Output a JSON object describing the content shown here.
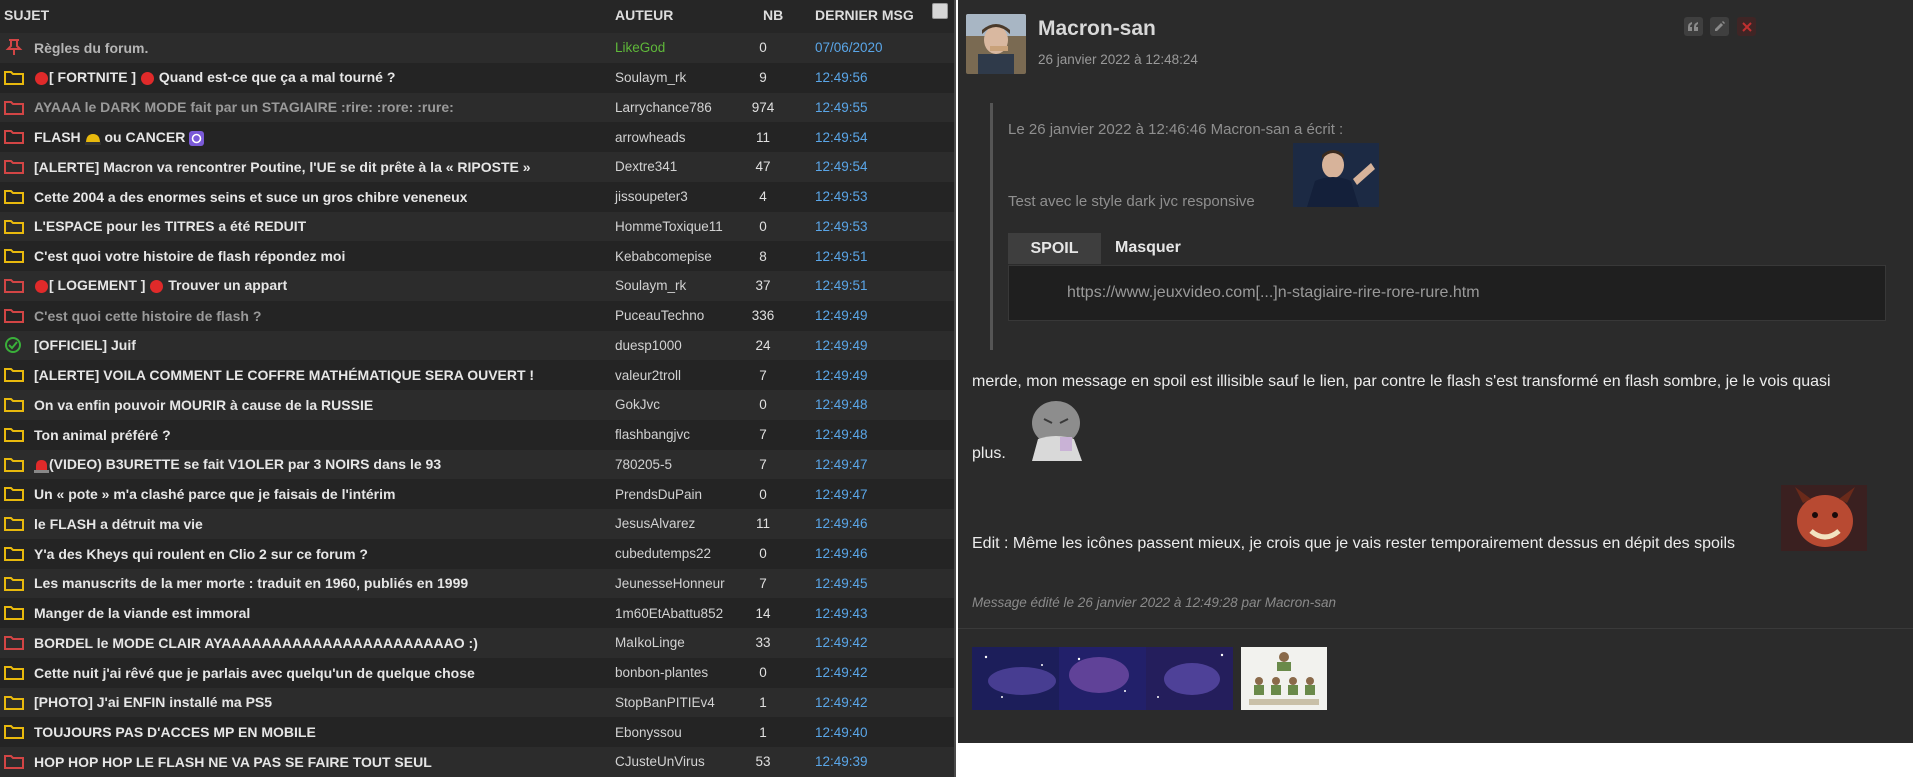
{
  "list": {
    "headers": {
      "subject": "SUJET",
      "author": "AUTEUR",
      "count": "NB",
      "last_msg": "DERNIER MSG"
    },
    "topics": [
      {
        "icon": "pin-icon",
        "subject": "Règles du forum.",
        "author": "LikeGod",
        "count": "0",
        "last": "07/06/2020",
        "style": "pin",
        "author_style": "green"
      },
      {
        "icon": "folder-yellow-icon",
        "pre": "red-dot",
        "subject": "[ FORTNITE ]",
        "mid": "red-dot",
        "subject2": "Quand est-ce que ça a mal tourné ?",
        "author": "Soulaym_rk",
        "count": "9",
        "last": "12:49:56"
      },
      {
        "icon": "folder-red-icon",
        "subject": "AYAAA le DARK MODE fait par un STAGIAIRE :rire: :rore: :rure:",
        "author": "Larrychance786",
        "count": "974",
        "last": "12:49:55",
        "style": "grey"
      },
      {
        "icon": "folder-red-icon",
        "subject": "FLASH",
        "mid": "helmet",
        "subject2": "ou CANCER",
        "post": "cycle",
        "author": "arrowheads",
        "count": "11",
        "last": "12:49:54"
      },
      {
        "icon": "folder-red-icon",
        "subject": "[ALERTE] Macron va rencontrer Poutine, l'UE se dit prête à la « RIPOSTE »",
        "author": "Dextre341",
        "count": "47",
        "last": "12:49:54"
      },
      {
        "icon": "folder-yellow-icon",
        "subject": "Cette 2004 a des enormes seins et suce un gros chibre veneneux",
        "author": "jissoupeter3",
        "count": "4",
        "last": "12:49:53"
      },
      {
        "icon": "folder-yellow-icon",
        "subject": "L'ESPACE pour les TITRES a été REDUIT",
        "author": "HommeToxique11",
        "count": "0",
        "last": "12:49:53"
      },
      {
        "icon": "folder-yellow-icon",
        "subject": "C'est quoi votre histoire de flash répondez moi",
        "author": "Kebabcomepise",
        "count": "8",
        "last": "12:49:51"
      },
      {
        "icon": "folder-red-icon",
        "pre": "red-dot",
        "subject": "[ LOGEMENT ]",
        "mid": "red-dot",
        "subject2": "Trouver un appart",
        "author": "Soulaym_rk",
        "count": "37",
        "last": "12:49:51"
      },
      {
        "icon": "folder-red-icon",
        "subject": "C'est quoi cette histoire de flash ?",
        "author": "PuceauTechno",
        "count": "336",
        "last": "12:49:49",
        "style": "grey"
      },
      {
        "icon": "check-green-icon",
        "subject": "[OFFICIEL] Juif",
        "author": "duesp1000",
        "count": "24",
        "last": "12:49:49"
      },
      {
        "icon": "folder-yellow-icon",
        "subject": "[ALERTE] VOILA COMMENT LE COFFRE MATHÉMATIQUE SERA OUVERT !",
        "author": "valeur2troll",
        "count": "7",
        "last": "12:49:49"
      },
      {
        "icon": "folder-yellow-icon",
        "subject": "On va enfin pouvoir MOURIR à cause de la RUSSIE",
        "author": "GokJvc",
        "count": "0",
        "last": "12:49:48"
      },
      {
        "icon": "folder-yellow-icon",
        "subject": "Ton animal préféré ?",
        "author": "flashbangjvc",
        "count": "7",
        "last": "12:49:48"
      },
      {
        "icon": "folder-yellow-icon",
        "pre": "siren",
        "subject": "(VIDEO) B3URETTE se fait V1OLER par 3 NOIRS dans le 93",
        "author": "780205-5",
        "count": "7",
        "last": "12:49:47"
      },
      {
        "icon": "folder-yellow-icon",
        "subject": "Un « pote » m'a clashé parce que je faisais de l'intérim",
        "author": "PrendsDuPain",
        "count": "0",
        "last": "12:49:47"
      },
      {
        "icon": "folder-yellow-icon",
        "subject": "le FLASH a détruit ma vie",
        "author": "JesusAlvarez",
        "count": "11",
        "last": "12:49:46"
      },
      {
        "icon": "folder-yellow-icon",
        "subject": "Y'a des Kheys qui roulent en Clio 2 sur ce forum ?",
        "author": "cubedutemps22",
        "count": "0",
        "last": "12:49:46"
      },
      {
        "icon": "folder-yellow-icon",
        "subject": "Les manuscrits de la mer morte : traduit en 1960, publiés en 1999",
        "author": "JeunesseHonneur",
        "count": "7",
        "last": "12:49:45"
      },
      {
        "icon": "folder-yellow-icon",
        "subject": "Manger de la viande est immoral",
        "author": "1m60EtAbattu852",
        "count": "14",
        "last": "12:49:43"
      },
      {
        "icon": "folder-red-icon",
        "subject": "BORDEL le MODE CLAIR AYAAAAAAAAAAAAAAAAAAAAAAAO :)",
        "author": "MaIkoLinge",
        "count": "33",
        "last": "12:49:42"
      },
      {
        "icon": "folder-yellow-icon",
        "subject": "Cette nuit j'ai rêvé que je parlais avec quelqu'un de quelque chose",
        "author": "bonbon-plantes",
        "count": "0",
        "last": "12:49:42"
      },
      {
        "icon": "folder-yellow-icon",
        "subject": "[PHOTO] J'ai ENFIN installé ma PS5",
        "author": "StopBanPITIEv4",
        "count": "1",
        "last": "12:49:42"
      },
      {
        "icon": "folder-yellow-icon",
        "subject": "TOUJOURS PAS D'ACCES MP EN MOBILE",
        "author": "Ebonyssou",
        "count": "1",
        "last": "12:49:40"
      },
      {
        "icon": "folder-red-icon",
        "subject": "HOP HOP HOP LE FLASH NE VA PAS SE FAIRE TOUT SEUL",
        "author": "CJusteUnVirus",
        "count": "53",
        "last": "12:49:39"
      }
    ]
  },
  "message": {
    "author": "Macron-san",
    "date": "26 janvier 2022 à 12:48:24",
    "tools": [
      "quote-icon",
      "edit-icon",
      "delete-icon"
    ],
    "quote": {
      "header": "Le 26 janvier 2022 à 12:46:46 Macron-san a écrit :",
      "text": "Test avec le style dark jvc responsive",
      "spoil_label": "SPOIL",
      "hide_label": "Masquer",
      "spoil_link": "https://www.jeuxvideo.com[...]n-stagiaire-rire-rore-rure.htm"
    },
    "body_line1": "merde, mon message en spoil est illisible sauf le lien, par contre le flash s'est transformé en flash sombre, je le vois quasi",
    "body_line2": "plus.",
    "body_line3": "Edit : Même les icônes passent mieux, je crois que je vais rester temporairement dessus en dépit des spoils",
    "edited": "Message édité le 26 janvier 2022 à 12:49:28 par Macron-san"
  },
  "colors": {
    "folder_yellow": "#e8b90d",
    "folder_red": "#d24545",
    "link_blue": "#5aa6e8",
    "author_green": "#5fb83a"
  }
}
